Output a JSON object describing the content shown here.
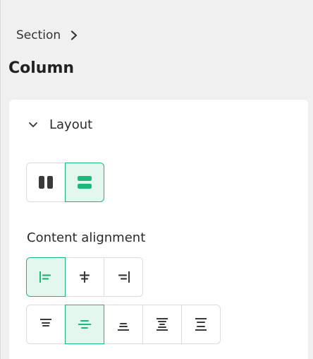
{
  "breadcrumb": {
    "parent_label": "Section",
    "separator_icon": "chevron-right-icon"
  },
  "page": {
    "title": "Column"
  },
  "layout_section": {
    "label": "Layout",
    "expanded": true,
    "toggle_icon": "chevron-down-icon",
    "layout_options": [
      {
        "icon": "columns-icon",
        "active": false
      },
      {
        "icon": "rows-icon",
        "active": true
      }
    ]
  },
  "content_alignment": {
    "label": "Content alignment",
    "horizontal_options": [
      {
        "icon": "align-left-icon",
        "active": true
      },
      {
        "icon": "align-center-icon",
        "active": false
      },
      {
        "icon": "align-right-icon",
        "active": false
      }
    ],
    "vertical_options": [
      {
        "icon": "align-top-icon",
        "active": false
      },
      {
        "icon": "align-middle-icon",
        "active": true
      },
      {
        "icon": "align-bottom-icon",
        "active": false
      },
      {
        "icon": "space-between-icon",
        "active": false
      },
      {
        "icon": "space-around-icon",
        "active": false
      }
    ]
  },
  "colors": {
    "accent": "#1fb77a",
    "active_bg": "#e4f7ee",
    "icon_gray": "#3a3a3a",
    "page_bg": "#f0f0f0"
  }
}
